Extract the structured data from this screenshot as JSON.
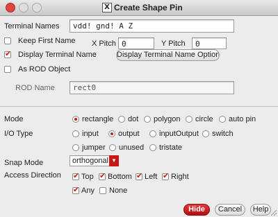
{
  "window": {
    "title": "Create Shape Pin",
    "app_badge": "X"
  },
  "terminal_names": {
    "label": "Terminal Names",
    "value": "vdd! gnd! A Z"
  },
  "keep_first_name": {
    "label": "Keep First Name",
    "checked": false
  },
  "x_pitch": {
    "label": "X Pitch",
    "value": "0"
  },
  "y_pitch": {
    "label": "Y Pitch",
    "value": "0"
  },
  "display_terminal_name": {
    "label": "Display Terminal Name",
    "checked": true,
    "button": "Display Terminal Name Option..."
  },
  "as_rod_object": {
    "label": "As ROD Object",
    "checked": false
  },
  "rod_name": {
    "label": "ROD Name",
    "value": "rect0"
  },
  "mode": {
    "label": "Mode",
    "options": [
      "rectangle",
      "dot",
      "polygon",
      "circle",
      "auto pin"
    ],
    "selected": "rectangle"
  },
  "io_type": {
    "label": "I/O Type",
    "options_row1": [
      "input",
      "output",
      "inputOutput",
      "switch"
    ],
    "options_row2": [
      "jumper",
      "unused",
      "tristate"
    ],
    "selected": "output"
  },
  "snap_mode": {
    "label": "Snap Mode",
    "value": "orthogonal"
  },
  "access_direction": {
    "label": "Access Direction",
    "row1": [
      {
        "label": "Top",
        "checked": true
      },
      {
        "label": "Bottom",
        "checked": true
      },
      {
        "label": "Left",
        "checked": true
      },
      {
        "label": "Right",
        "checked": true
      }
    ],
    "row2": [
      {
        "label": "Any",
        "checked": true
      },
      {
        "label": "None",
        "checked": false
      }
    ]
  },
  "buttons": {
    "hide": "Hide",
    "cancel": "Cancel",
    "help": "Help"
  },
  "colors": {
    "accent": "#c81a1a",
    "background": "#ececec"
  }
}
